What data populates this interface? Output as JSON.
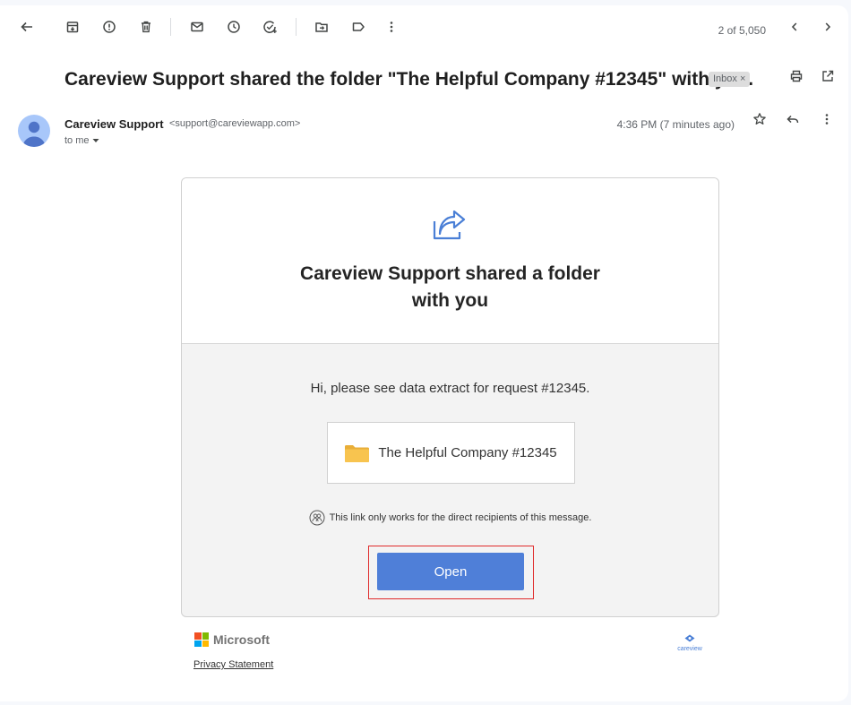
{
  "toolbar": {
    "icons": [
      "back-arrow-icon",
      "archive-icon",
      "report-spam-icon",
      "delete-icon",
      "mark-unread-icon",
      "snooze-icon",
      "add-task-icon",
      "move-to-icon",
      "label-icon",
      "more-vert-icon"
    ],
    "pager_text": "2 of 5,050"
  },
  "subject": {
    "text": "Careview Support shared the folder \"The Helpful Company #12345\" with you.",
    "label": "Inbox"
  },
  "message": {
    "sender_name": "Careview Support",
    "sender_email": "<support@careviewapp.com>",
    "recipient": "to me",
    "timestamp": "4:36 PM (7 minutes ago)"
  },
  "card": {
    "title_line1": "Careview Support shared a folder",
    "title_line2": "with you",
    "body_text": "Hi, please see data extract for request #12345.",
    "folder_name": "The Helpful Company #12345",
    "notice_text": "This link only works for the direct recipients of this message.",
    "open_label": "Open"
  },
  "footer": {
    "microsoft_text": "Microsoft",
    "privacy_link": "Privacy Statement",
    "careview_logo_text": "careview"
  },
  "colors": {
    "accent": "#4f7fd8",
    "highlight_border": "#e02b2b",
    "folder_yellow": "#f8c44f",
    "avatar_bg": "#a8c7fa"
  }
}
